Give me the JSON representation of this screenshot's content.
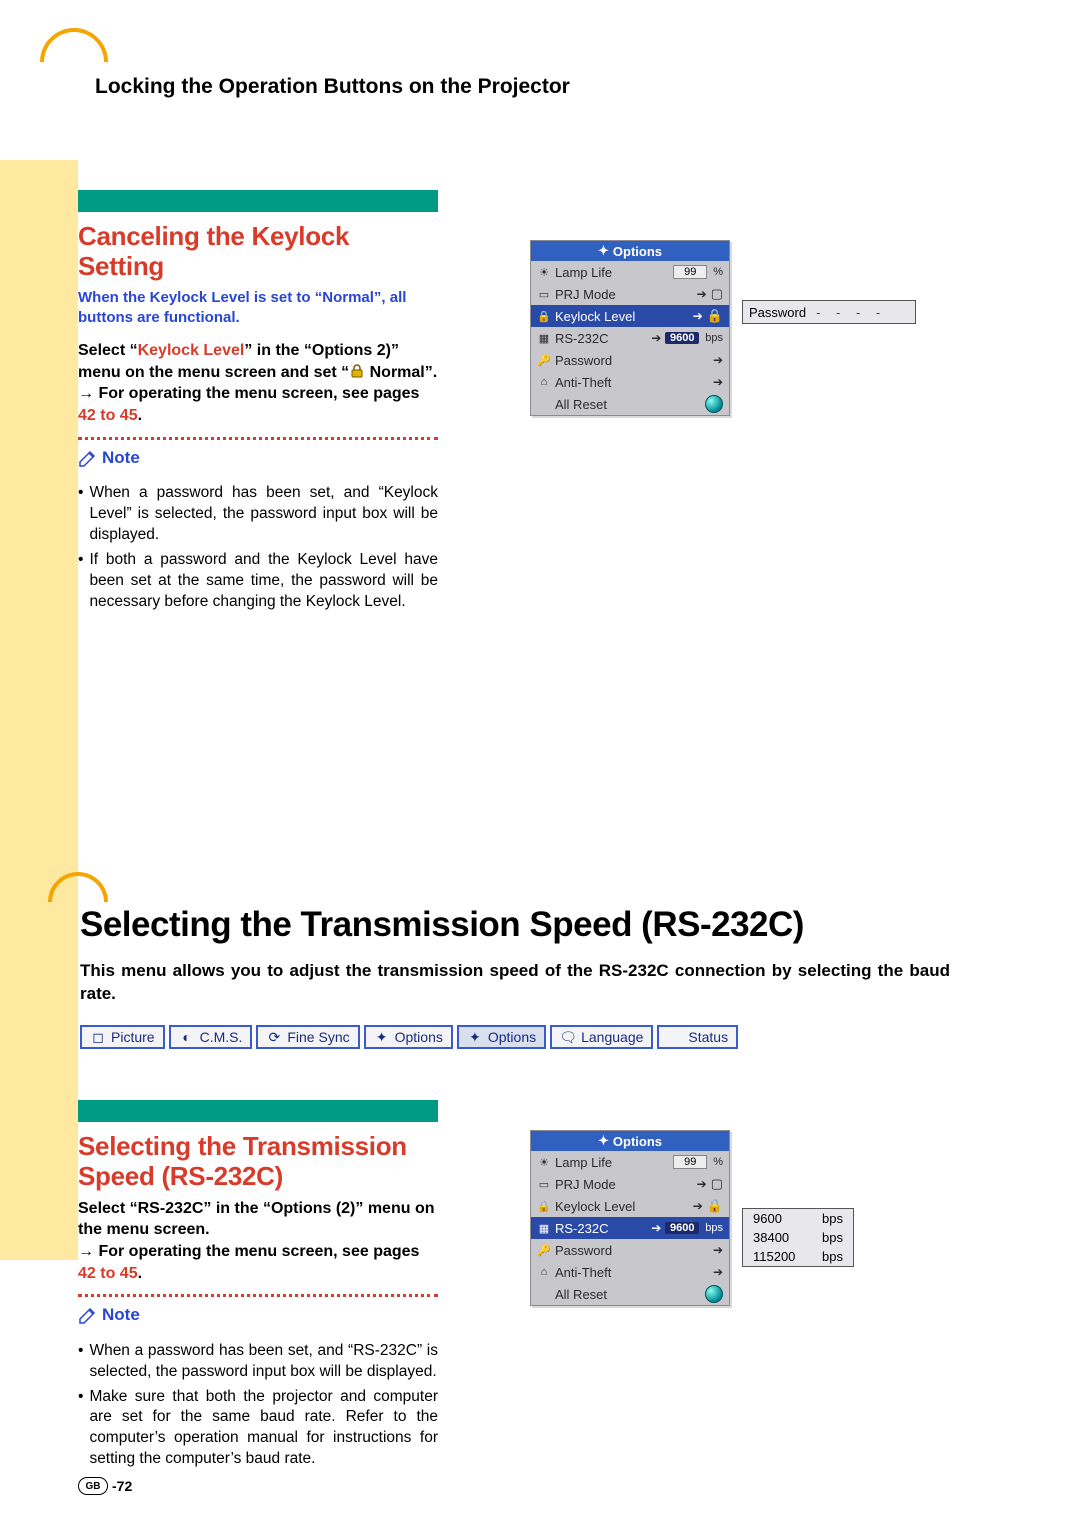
{
  "page": {
    "title": "Locking the Operation Buttons on the Projector",
    "number_label": "-72",
    "region": "GB"
  },
  "cancel_section": {
    "heading": "Canceling the Keylock Setting",
    "intro": "When the Keylock Level is set to “Normal”, all buttons are functional.",
    "p1a": "Select “",
    "p1b": "Keylock Level",
    "p1c": "” in the “Options 2)” menu on the menu screen and set “",
    "p1d": " Normal”.",
    "p2a": "→ For operating the menu screen, see pages ",
    "p2b": "42 to 45",
    "p2c": ".",
    "note_label": "Note",
    "notes": [
      "When a password has been set, and “Keylock Level” is selected, the password input box will be displayed.",
      "If both a password and the Keylock Level have been set at the same time, the password will be necessary before changing the Keylock Level."
    ]
  },
  "rs_section": {
    "big_heading": "Selecting the Transmission Speed (RS-232C)",
    "intro": "This menu allows you to adjust the transmission speed of the RS-232C connection by selecting the baud rate.",
    "sub_heading": "Selecting the Transmission Speed (RS-232C)",
    "p1": "Select “RS-232C” in the “Options (2)” menu on the menu screen.",
    "p2a": "→ For operating the menu screen, see pages ",
    "p2b": "42 to 45",
    "p2c": ".",
    "note_label": "Note",
    "notes": [
      "When a password has been set, and “RS-232C” is selected, the password input box will be displayed.",
      "Make sure that both the projector and computer are set for the same baud rate. Refer to the computer’s operation manual for instructions for setting the computer’s baud rate."
    ]
  },
  "tabs": [
    {
      "label": "Picture",
      "icon": "picture"
    },
    {
      "label": "C.M.S.",
      "icon": "cms"
    },
    {
      "label": "Fine Sync",
      "icon": "sync"
    },
    {
      "label": "Options",
      "icon": "opt"
    },
    {
      "label": "Options",
      "icon": "opt",
      "selected": true
    },
    {
      "label": "Language",
      "icon": "lang"
    },
    {
      "label": "Status",
      "icon": "status"
    }
  ],
  "osd": {
    "title": "Options",
    "lamp_value": "99",
    "lamp_unit": "%",
    "rs_value": "9600",
    "rs_unit": "bps",
    "rows": [
      {
        "icon": "lamp",
        "label": "Lamp Life",
        "extra": "lamp"
      },
      {
        "icon": "prj",
        "label": "PRJ Mode",
        "extra": "prjarrow"
      },
      {
        "icon": "key",
        "label": "Keylock Level",
        "extra": "keyarrow",
        "hl": false
      },
      {
        "icon": "rs",
        "label": "RS-232C",
        "extra": "rs",
        "hl": false
      },
      {
        "icon": "pwd",
        "label": "Password",
        "extra": "arrow"
      },
      {
        "icon": "anti",
        "label": "Anti-Theft",
        "extra": "arrow"
      },
      {
        "icon": "reset",
        "label": "All Reset",
        "extra": "circ"
      }
    ]
  },
  "osd1_highlight_index": 2,
  "osd2_highlight_index": 3,
  "password_box": {
    "label": "Password",
    "value": "- - - -"
  },
  "baud": {
    "options": [
      {
        "v": "9600",
        "u": "bps"
      },
      {
        "v": "38400",
        "u": "bps"
      },
      {
        "v": "115200",
        "u": "bps"
      }
    ]
  }
}
